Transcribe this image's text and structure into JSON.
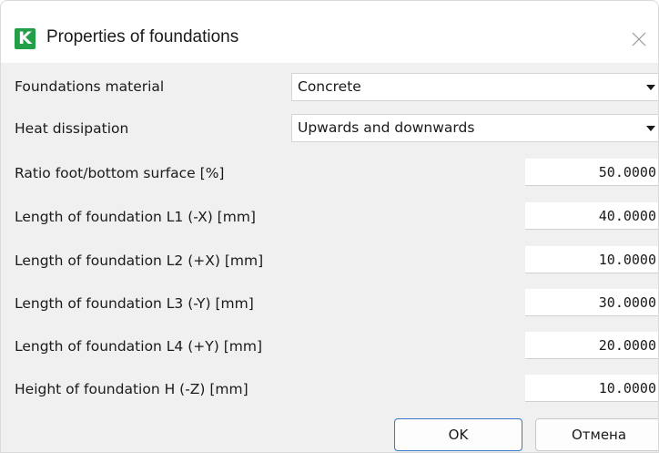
{
  "dialog": {
    "title": "Properties of foundations",
    "app_icon_letter": "K",
    "icons": {
      "app": "app-logo-icon",
      "close": "close-icon",
      "dropdown": "chevron-down-icon"
    },
    "colors": {
      "app_icon_bg": "#23a047",
      "ok_border": "#3c78c8"
    }
  },
  "fields": {
    "material": {
      "label": "Foundations material",
      "value": "Concrete"
    },
    "heat": {
      "label": "Heat dissipation",
      "value": "Upwards and downwards"
    },
    "ratio": {
      "label": "Ratio foot/bottom surface [%]",
      "value": "50.0000"
    },
    "l1": {
      "label": "Length of foundation L1 (-X) [mm]",
      "value": "40.0000"
    },
    "l2": {
      "label": "Length of foundation L2 (+X) [mm]",
      "value": "10.0000"
    },
    "l3": {
      "label": "Length of foundation L3 (-Y) [mm]",
      "value": "30.0000"
    },
    "l4": {
      "label": "Length of foundation L4 (+Y) [mm]",
      "value": "20.0000"
    },
    "h": {
      "label": "Height of foundation H (-Z) [mm]",
      "value": "10.0000"
    }
  },
  "buttons": {
    "ok": "OK",
    "cancel": "Отмена"
  }
}
